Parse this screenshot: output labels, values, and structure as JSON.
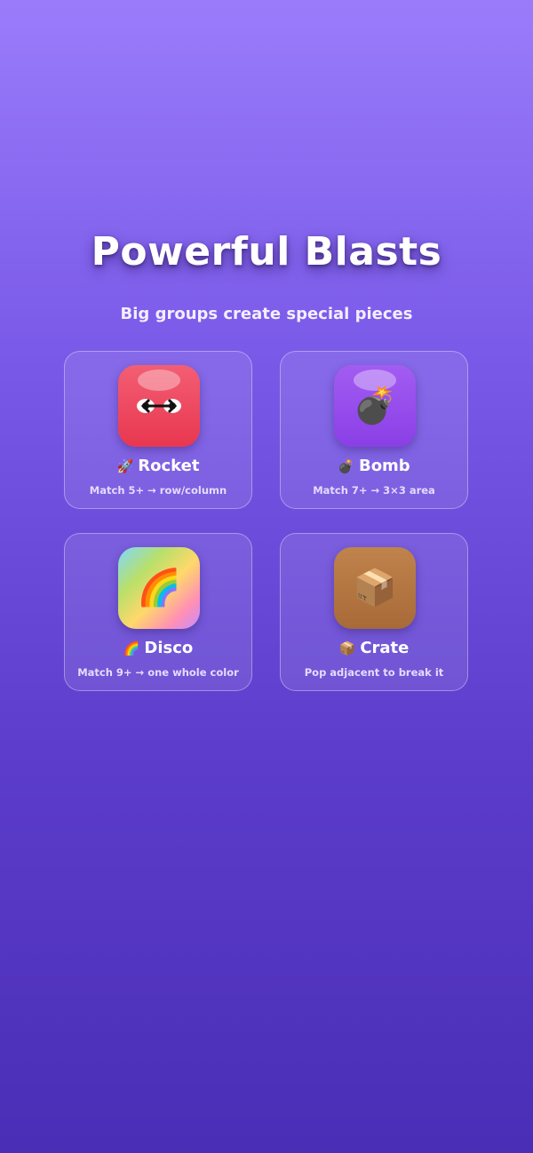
{
  "screen": {
    "title": "Powerful Blasts",
    "subtitle": "Big groups create special pieces"
  },
  "pieces": [
    {
      "emoji": "🚀",
      "name": "Rocket",
      "description": "Match 5+ → row/column",
      "tile_icon": "double-arrow-eyes-icon",
      "tile_color": "#eb3f56"
    },
    {
      "emoji": "💣",
      "name": "Bomb",
      "description": "Match 7+ → 3×3 area",
      "tile_glyph": "💣",
      "tile_icon": "bomb-icon",
      "tile_color": "#9048ea"
    },
    {
      "emoji": "🌈",
      "name": "Disco",
      "description": "Match 9+ → one whole color",
      "tile_glyph": "🌈",
      "tile_icon": "rainbow-icon",
      "tile_color": "#ffd86b"
    },
    {
      "emoji": "📦",
      "name": "Crate",
      "description": "Pop adjacent to break it",
      "tile_glyph": "📦",
      "tile_icon": "crate-icon",
      "tile_color": "#b0733f"
    }
  ]
}
